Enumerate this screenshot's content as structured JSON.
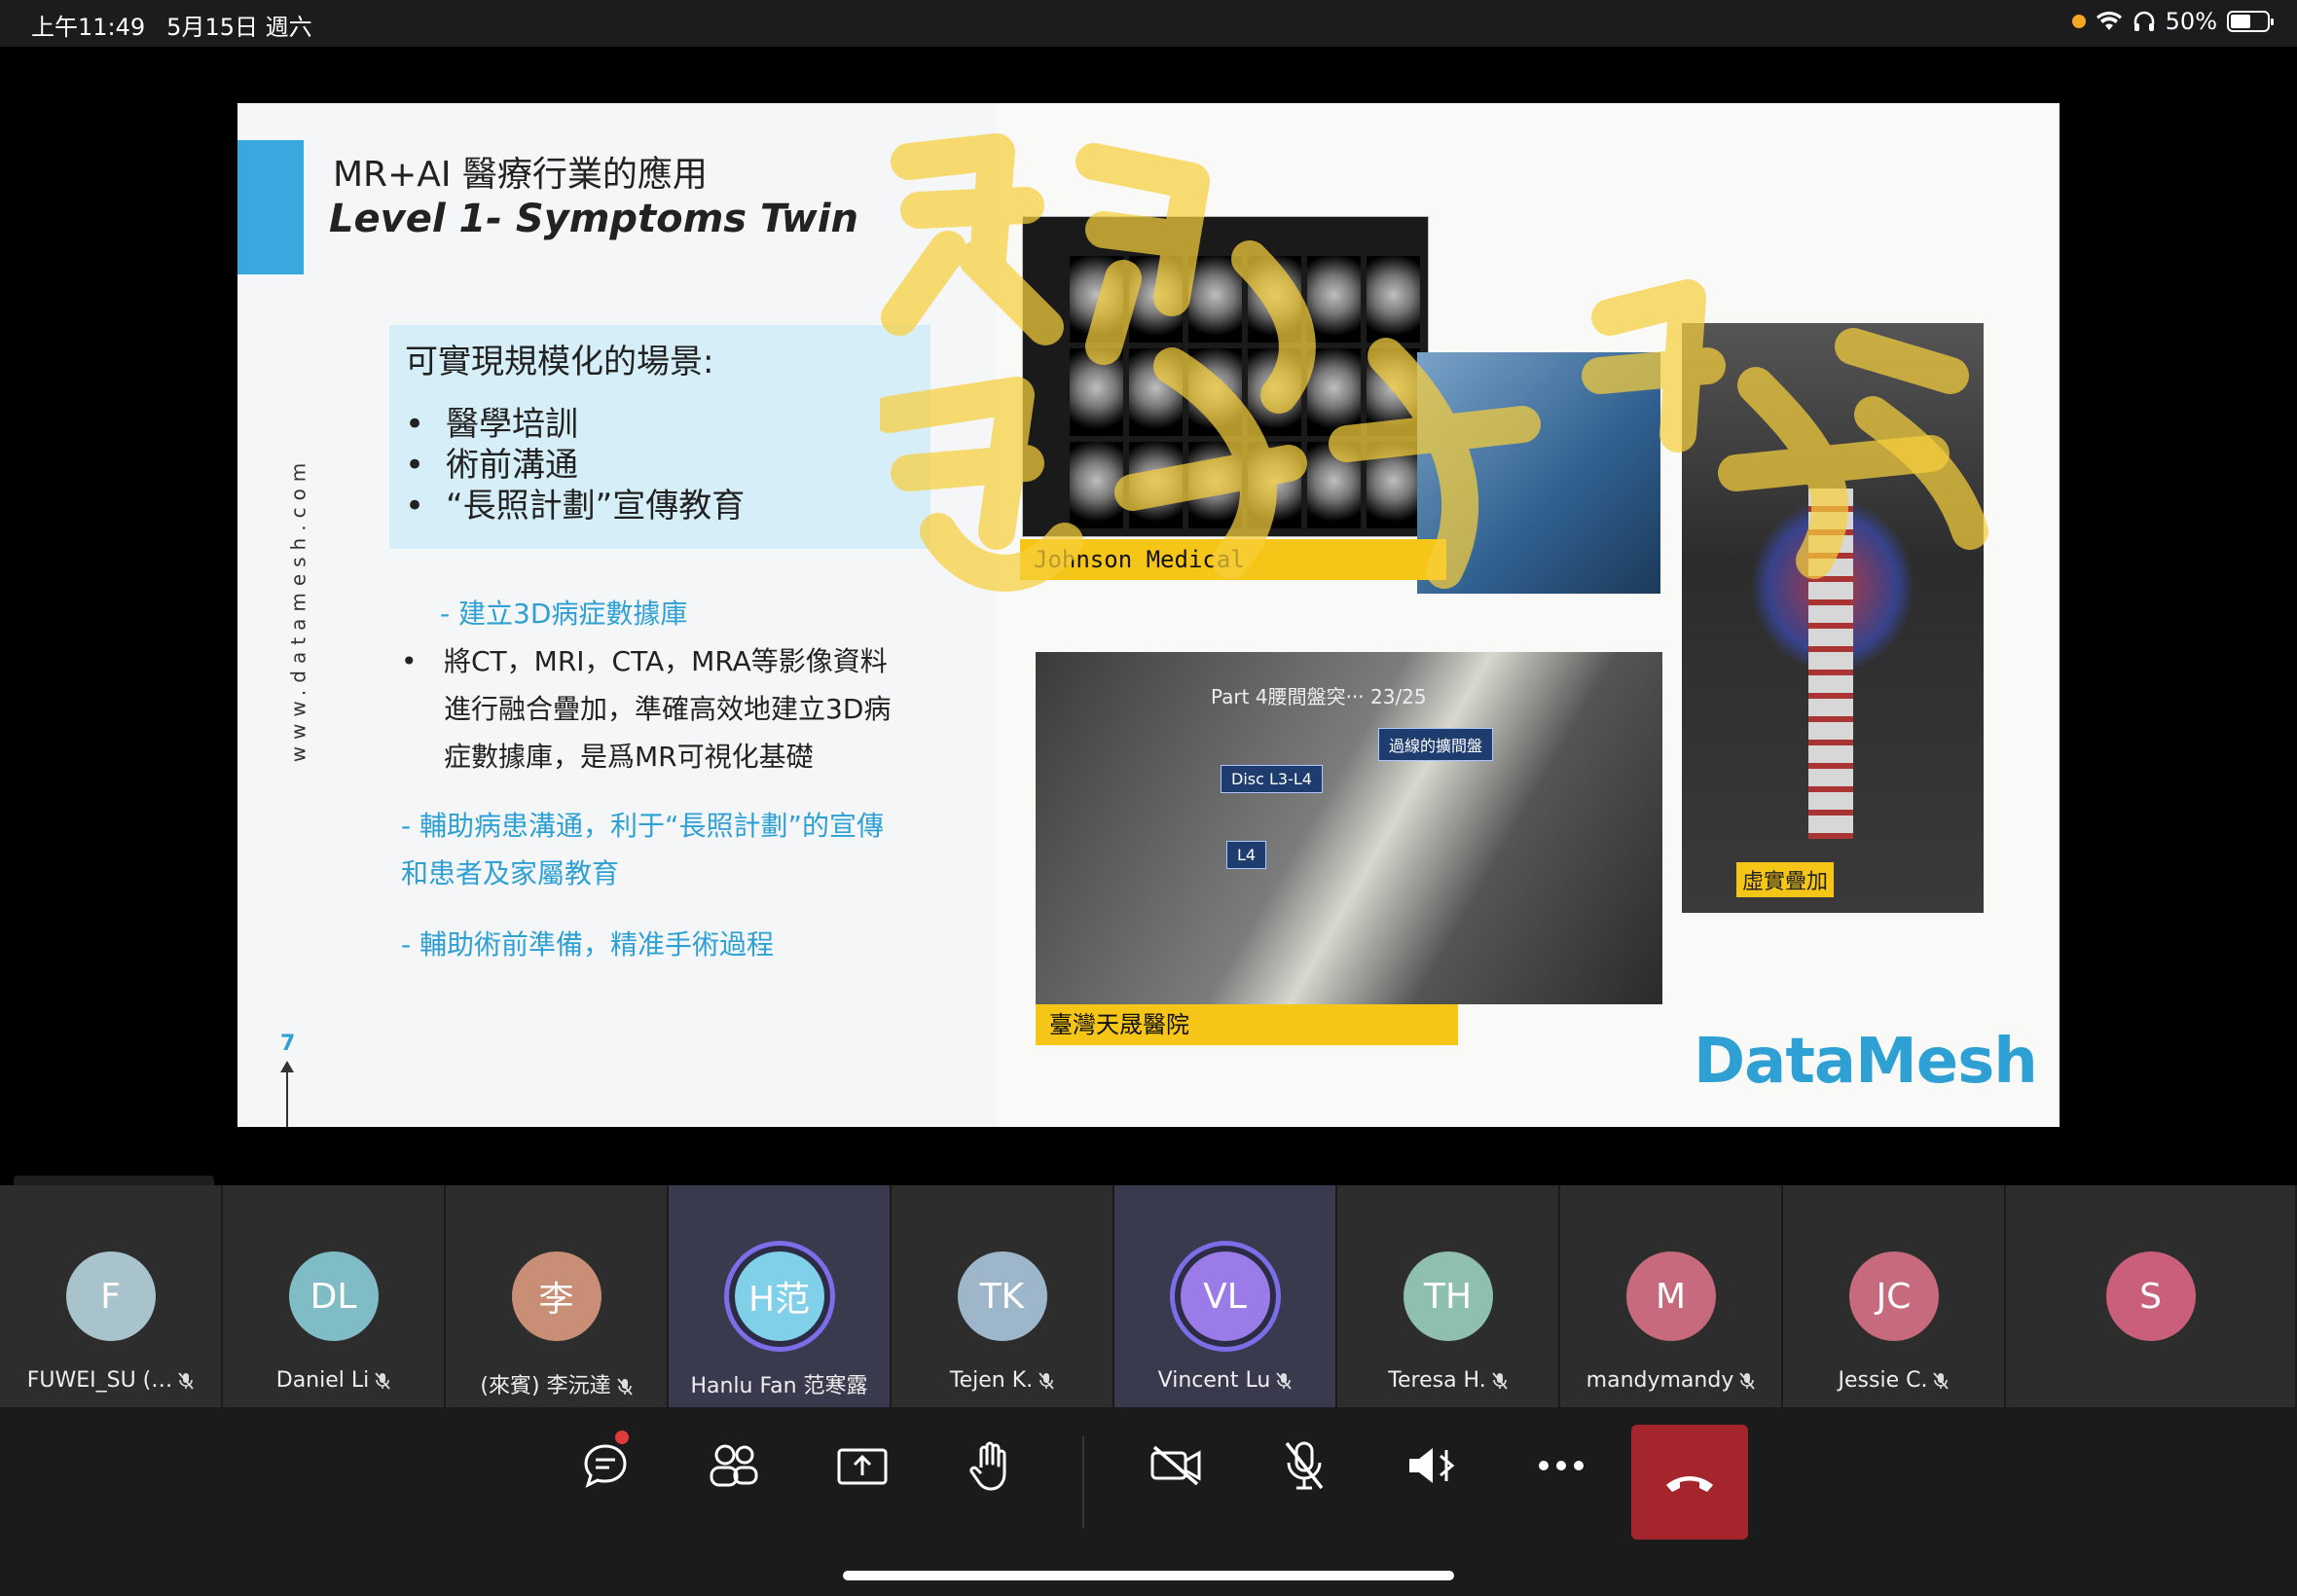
{
  "status": {
    "time": "上午11:49",
    "date": "5月15日 週六",
    "battery": "50%"
  },
  "slide": {
    "title_main": "MR+AI 醫療行業的應用",
    "title_sub": "Level 1- Symptoms Twin",
    "scenario_title": "可實現規模化的場景:",
    "scenarios": [
      "醫學培訓",
      "術前溝通",
      "“長照計劃”宣傳教育"
    ],
    "b1": "- 建立3D病症數據庫",
    "b2": "將CT，MRI，CTA，MRA等影像資料進行融合疊加，準確高效地建立3D病症數據庫，是爲MR可視化基礎",
    "b3": "- 輔助病患溝通，利于“長照計劃”的宣傳和患者及家屬教育",
    "b4": "- 輔助術前準備，精准手術過程",
    "website": "www.datamesh.com",
    "page": "7",
    "caption_johnson": "Johnson Medical",
    "caption_taiwan": "臺灣天晟醫院",
    "visual_title": "Part 4腰間盤突··· 23/25",
    "visual_disc": "Disc L3-L4",
    "visual_l4": "L4",
    "visual_nerve": "過線的擴間盤",
    "xr_label": "虛實疊加",
    "logo": "DataMesh"
  },
  "active_speaker": "Hanlu Fan 范寒露",
  "participants": [
    {
      "initials": "F",
      "name": "FUWEI_SU (…",
      "color": "#a9c3cc"
    },
    {
      "initials": "DL",
      "name": "Daniel Li",
      "color": "#7fbcc6"
    },
    {
      "initials": "李",
      "name": "(來賓) 李沅達",
      "color": "#c98f76"
    },
    {
      "initials": "H范",
      "name": "Hanlu Fan 范寒露",
      "color": "#7fd0e8"
    },
    {
      "initials": "TK",
      "name": "Tejen K.",
      "color": "#9db6c9"
    },
    {
      "initials": "VL",
      "name": "Vincent Lu",
      "color": "#9b7be8"
    },
    {
      "initials": "TH",
      "name": "Teresa H.",
      "color": "#8fbfae"
    },
    {
      "initials": "M",
      "name": "mandymandy",
      "color": "#c76a7e"
    },
    {
      "initials": "JC",
      "name": "Jessie C.",
      "color": "#c76a7e"
    },
    {
      "initials": "S",
      "name": "",
      "color": "#c95f7a"
    }
  ],
  "icons": [
    "chat-icon",
    "people-icon",
    "share-screen-icon",
    "raise-hand-icon",
    "camera-off-icon",
    "mic-off-icon",
    "speaker-icon",
    "more-icon",
    "hangup-icon"
  ]
}
